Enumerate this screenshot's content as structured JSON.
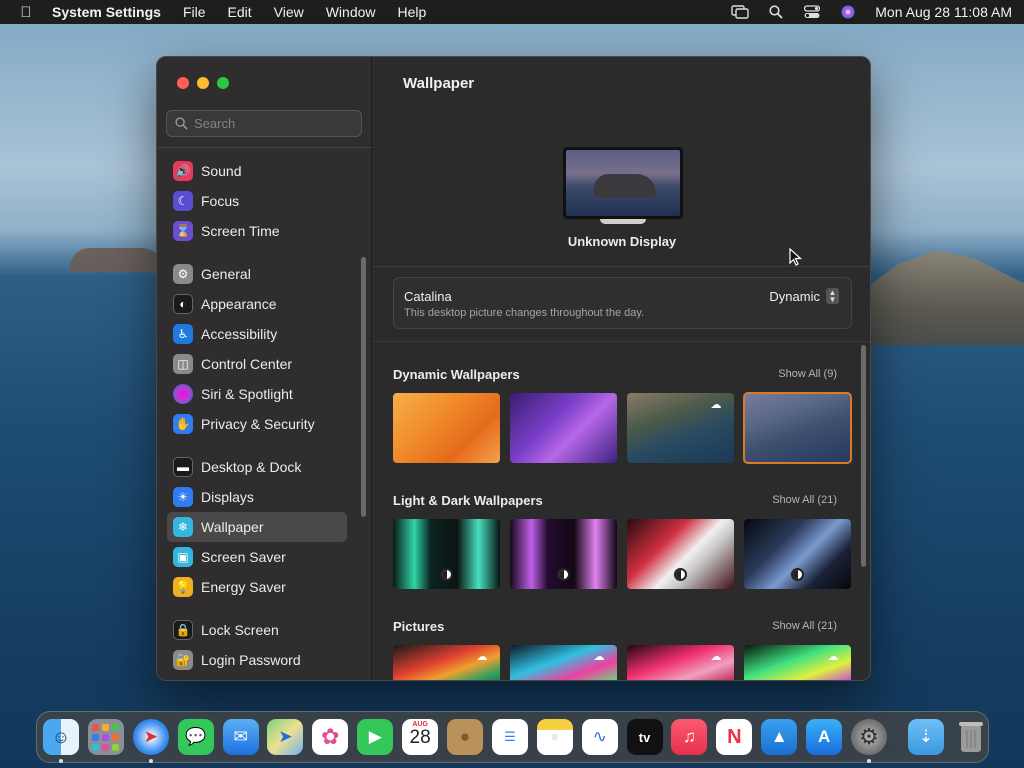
{
  "menubar": {
    "app_name": "System Settings",
    "menus": [
      "File",
      "Edit",
      "View",
      "Window",
      "Help"
    ],
    "clock": "Mon Aug 28  11:08 AM"
  },
  "sidebar": {
    "search_placeholder": "Search",
    "items": [
      {
        "label": "Sound",
        "icon": "speaker-icon",
        "color": "#e8395a"
      },
      {
        "label": "Focus",
        "icon": "moon-icon",
        "color": "#5a4fd0"
      },
      {
        "label": "Screen Time",
        "icon": "hourglass-icon",
        "color": "#6b4fd0"
      },
      {
        "label": "General",
        "icon": "gear-icon",
        "color": "#8a8a8a"
      },
      {
        "label": "Appearance",
        "icon": "appearance-icon",
        "color": "#1a1a1a"
      },
      {
        "label": "Accessibility",
        "icon": "accessibility-icon",
        "color": "#1f7ae0"
      },
      {
        "label": "Control Center",
        "icon": "control-center-icon",
        "color": "#8a8a8a"
      },
      {
        "label": "Siri & Spotlight",
        "icon": "siri-icon",
        "color": "#b044c8"
      },
      {
        "label": "Privacy & Security",
        "icon": "hand-icon",
        "color": "#2f7df0"
      },
      {
        "label": "Desktop & Dock",
        "icon": "dock-icon",
        "color": "#1a1a1a"
      },
      {
        "label": "Displays",
        "icon": "sun-icon",
        "color": "#2f7df0"
      },
      {
        "label": "Wallpaper",
        "icon": "wallpaper-icon",
        "color": "#35b6e0"
      },
      {
        "label": "Screen Saver",
        "icon": "screen-saver-icon",
        "color": "#35b6e0"
      },
      {
        "label": "Energy Saver",
        "icon": "lightbulb-icon",
        "color": "#f0b020"
      },
      {
        "label": "Lock Screen",
        "icon": "lock-icon",
        "color": "#1a1a1a"
      },
      {
        "label": "Login Password",
        "icon": "padlock-icon",
        "color": "#8a8a8a"
      }
    ]
  },
  "pane": {
    "title": "Wallpaper",
    "display_name": "Unknown Display",
    "current": {
      "name": "Catalina",
      "description": "This desktop picture changes throughout the day.",
      "mode": "Dynamic"
    },
    "sections": [
      {
        "title": "Dynamic Wallpapers",
        "show_all": "Show All (9)"
      },
      {
        "title": "Light & Dark Wallpapers",
        "show_all": "Show All (21)"
      },
      {
        "title": "Pictures",
        "show_all": "Show All (21)"
      }
    ]
  },
  "dock": {
    "apps": [
      "Finder",
      "Launchpad",
      "Safari",
      "Messages",
      "Mail",
      "Maps",
      "Photos",
      "FaceTime",
      "Calendar",
      "Contacts",
      "Reminders",
      "Notes",
      "Freeform",
      "TV",
      "Music",
      "News",
      "Keynote",
      "App Store",
      "System Settings",
      "Downloads",
      "Trash"
    ],
    "calendar_month": "AUG",
    "calendar_day": "28",
    "tv_label": "tv"
  },
  "colors": {
    "accent_selection": "#d97a28",
    "close": "#ff5f57",
    "minimize": "#febc2e",
    "zoom": "#28c840"
  }
}
